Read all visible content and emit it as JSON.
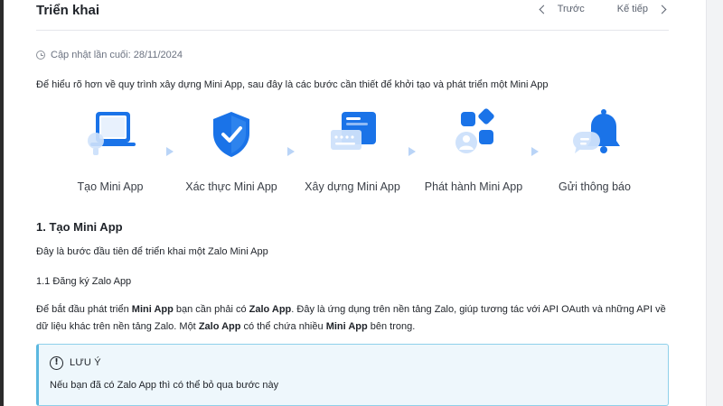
{
  "header": {
    "title": "Triển khai",
    "prev_label": "Trước",
    "next_label": "Kế tiếp"
  },
  "updated": "Cập nhật lần cuối: 28/11/2024",
  "intro": "Để hiểu rõ hơn về quy trình xây dựng Mini App, sau đây là các bước cần thiết để khởi tạo và phát triển một Mini App",
  "steps": [
    {
      "label": "Tạo Mini App",
      "icon": "laptop-icon"
    },
    {
      "label": "Xác thực Mini App",
      "icon": "shield-check-icon"
    },
    {
      "label": "Xây dựng Mini App",
      "icon": "build-window-icon"
    },
    {
      "label": "Phát hành Mini App",
      "icon": "app-grid-icon"
    },
    {
      "label": "Gửi thông báo",
      "icon": "bell-icon"
    }
  ],
  "section1": {
    "heading": "1. Tạo Mini App",
    "description": "Đây là bước đầu tiên để triển khai một Zalo Mini App",
    "sub_heading": "1.1 Đăng ký Zalo App",
    "para": {
      "t1": "Để bắt đầu phát triển ",
      "b1": "Mini App",
      "t2": " bạn cần phải có ",
      "b2": "Zalo App",
      "t3": ". Đây là ứng dụng trên nền tảng Zalo, giúp tương tác với API OAuth và những API về dữ liệu khác trên nền tảng Zalo. Một ",
      "b3": "Zalo App",
      "t4": " có thể chứa nhiều ",
      "b4": "Mini App",
      "t5": " bên trong."
    }
  },
  "note": {
    "icon": "exclamation-icon",
    "title": "LƯU Ý",
    "text": "Nếu bạn đã có Zalo App thì có thể bỏ qua bước này"
  },
  "colors": {
    "accent": "#1a73e8",
    "light_blue": "#cfe2fb",
    "note_bg": "#eef7fc",
    "note_border": "#8fd0ea"
  }
}
